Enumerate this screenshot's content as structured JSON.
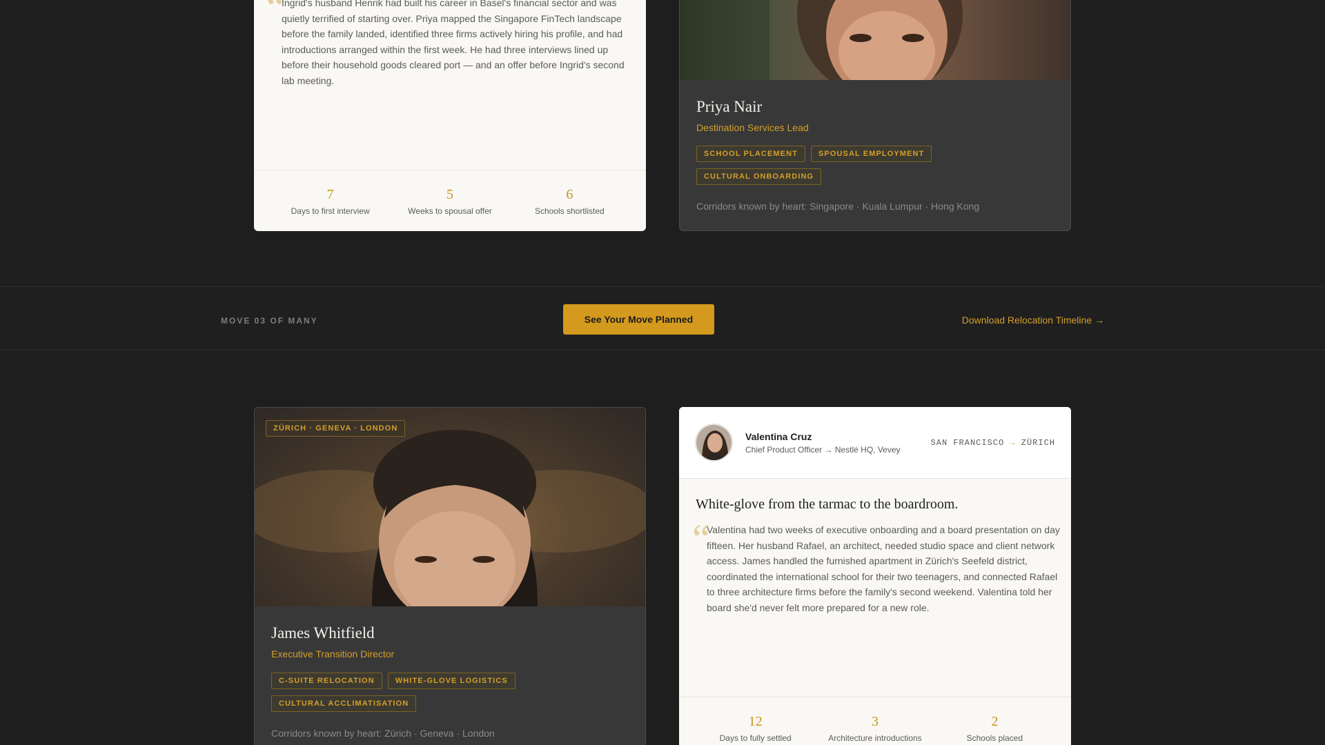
{
  "story_a": {
    "quote": "Ingrid's husband Henrik had built his career in Basel's financial sector and was quietly terrified of starting over. Priya mapped the Singapore FinTech landscape before the family landed, identified three firms actively hiring his profile, and had introductions arranged within the first week. He had three interviews lined up before their household goods cleared port — and an offer before Ingrid's second lab meeting.",
    "stats": [
      {
        "value": "7",
        "label": "Days to first interview"
      },
      {
        "value": "5",
        "label": "Weeks to spousal offer"
      },
      {
        "value": "6",
        "label": "Schools shortlisted"
      }
    ]
  },
  "consultant_a": {
    "name": "Priya Nair",
    "role": "Destination Services Lead",
    "tags": [
      "SCHOOL PLACEMENT",
      "SPOUSAL EMPLOYMENT",
      "CULTURAL ONBOARDING"
    ],
    "corridors": "Corridors known by heart: Singapore · Kuala Lumpur · Hong Kong"
  },
  "cta": {
    "move_count": "MOVE 03 OF MANY",
    "button": "See Your Move Planned",
    "download": "Download Relocation Timeline →"
  },
  "consultant_b": {
    "badge": "ZÜRICH · GENEVA · LONDON",
    "name": "James Whitfield",
    "role": "Executive Transition Director",
    "tags": [
      "C-SUITE RELOCATION",
      "WHITE-GLOVE LOGISTICS",
      "CULTURAL ACCLIMATISATION"
    ],
    "corridors": "Corridors known by heart: Zürich · Geneva · London"
  },
  "story_b": {
    "client_name": "Valentina Cruz",
    "client_role": "Chief Product Officer → Nestlé HQ, Vevey",
    "route_from": "SAN FRANCISCO",
    "route_arrow": "→",
    "route_to": "ZÜRICH",
    "headline": "White-glove from the tarmac to the boardroom.",
    "quote": "Valentina had two weeks of executive onboarding and a board presentation on day fifteen. Her husband Rafael, an architect, needed studio space and client network access. James handled the furnished apartment in Zürich's Seefeld district, coordinated the international school for their two teenagers, and connected Rafael to three architecture firms before the family's second weekend. Valentina told her board she'd never felt more prepared for a new role.",
    "stats": [
      {
        "value": "12",
        "label": "Days to fully settled"
      },
      {
        "value": "3",
        "label": "Architecture introductions"
      },
      {
        "value": "2",
        "label": "Schools placed"
      }
    ]
  },
  "colors": {
    "accent": "#d49a1e",
    "background": "#1e1e1e",
    "card_light": "#f9f8f4",
    "card_dark": "#383838"
  }
}
